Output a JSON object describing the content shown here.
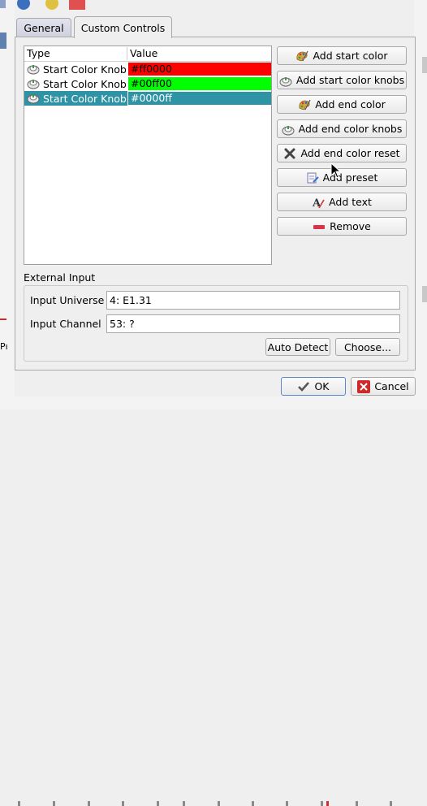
{
  "tabs": {
    "general": "General",
    "custom_controls": "Custom Controls"
  },
  "table": {
    "headers": {
      "type": "Type",
      "value": "Value"
    },
    "rows": [
      {
        "type": "Start Color Knob",
        "value": "#ff0000",
        "color": "#ff0000",
        "selected": false
      },
      {
        "type": "Start Color Knob",
        "value": "#00ff00",
        "color": "#00ff00",
        "selected": false
      },
      {
        "type": "Start Color Knob",
        "value": "#0000ff",
        "color": "#2e93a5",
        "selected": true
      }
    ]
  },
  "side_buttons": {
    "add_start_color": "Add start color",
    "add_start_color_knobs": "Add start color knobs",
    "add_end_color": "Add end color",
    "add_end_color_knobs": "Add end color knobs",
    "add_end_color_reset": "Add end color reset",
    "add_preset": "Add preset",
    "add_text": "Add text",
    "remove": "Remove"
  },
  "external_input": {
    "title": "External Input",
    "universe_label": "Input Universe",
    "universe_value": "4: E1.31",
    "channel_label": "Input Channel",
    "channel_value": "53: ?",
    "auto_detect": "Auto Detect",
    "choose": "Choose..."
  },
  "dialog_buttons": {
    "ok": "OK",
    "cancel": "Cancel"
  },
  "colors": {
    "selection": "#2e93a5",
    "remove_bar": "#d9334a"
  }
}
